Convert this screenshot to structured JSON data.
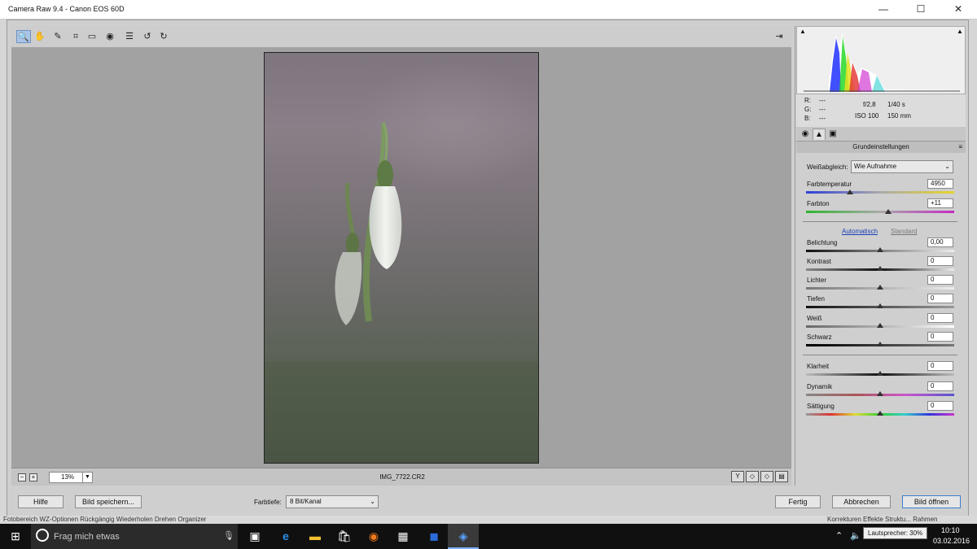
{
  "window": {
    "title": "Camera Raw 9.4 - Canon EOS 60D"
  },
  "window_controls": {
    "minimize": "—",
    "maximize": "☐",
    "close": "✕"
  },
  "toolbar": {
    "tools": [
      {
        "icon": "zoom-icon",
        "glyph": "🔍"
      },
      {
        "icon": "hand-icon",
        "glyph": "✋"
      },
      {
        "icon": "eyedropper-icon",
        "glyph": "✎"
      },
      {
        "icon": "crop-icon",
        "glyph": "⌗"
      },
      {
        "icon": "straighten-icon",
        "glyph": "▭"
      },
      {
        "icon": "redeye-icon",
        "glyph": "◉"
      },
      {
        "icon": "list-icon",
        "glyph": "☰"
      },
      {
        "icon": "rotate-left-icon",
        "glyph": "↺"
      },
      {
        "icon": "rotate-right-icon",
        "glyph": "↻"
      }
    ],
    "export_icon": "⇥"
  },
  "preview": {
    "zoom": "13%",
    "filename": "IMG_7722.CR2",
    "zoom_out_glyph": "−",
    "zoom_in_glyph": "+",
    "view_buttons": [
      "Y",
      "◇",
      "◇",
      "▤"
    ]
  },
  "histogram": {
    "warn_left": "▲",
    "warn_right": "▲"
  },
  "info": {
    "r_label": "R:",
    "r_val": "---",
    "g_label": "G:",
    "g_val": "---",
    "b_label": "B:",
    "b_val": "---",
    "aperture": "f/2,8",
    "shutter": "1/40 s",
    "iso": "ISO 100",
    "focal": "150 mm"
  },
  "panel_tabs": [
    "◉",
    "▲",
    "▣"
  ],
  "section": {
    "title": "Grundeinstellungen",
    "menu_glyph": "≡"
  },
  "white_balance": {
    "label": "Weißabgleich:",
    "value": "Wie Aufnahme"
  },
  "sliders_wb": [
    {
      "label": "Farbtemperatur",
      "value": "4950"
    },
    {
      "label": "Farbton",
      "value": "+11"
    }
  ],
  "auto_link": "Automatisch",
  "standard_link": "Standard",
  "sliders_tone": [
    {
      "label": "Belichtung",
      "value": "0,00"
    },
    {
      "label": "Kontrast",
      "value": "0"
    },
    {
      "label": "Lichter",
      "value": "0"
    },
    {
      "label": "Tiefen",
      "value": "0"
    },
    {
      "label": "Weiß",
      "value": "0"
    },
    {
      "label": "Schwarz",
      "value": "0"
    }
  ],
  "sliders_presence": [
    {
      "label": "Klarheit",
      "value": "0"
    },
    {
      "label": "Dynamik",
      "value": "0"
    },
    {
      "label": "Sättigung",
      "value": "0"
    }
  ],
  "bottom": {
    "help": "Hilfe",
    "save": "Bild speichern...",
    "depth_label": "Farbtiefe:",
    "depth_value": "8 Bit/Kanal",
    "done": "Fertig",
    "cancel": "Abbrechen",
    "open": "Bild öffnen"
  },
  "behind_text": "Fotobereich   WZ-Optionen   Rückgängig   Wiederholen   Drehen   Organizer",
  "behind_text_right": "Korrekturen   Effekte   Struktu...   Rahmen",
  "taskbar": {
    "search_placeholder": "Frag mich etwas",
    "volume_tooltip": "Lautsprecher: 30%",
    "time": "10:10",
    "date": "03.02.2016"
  }
}
